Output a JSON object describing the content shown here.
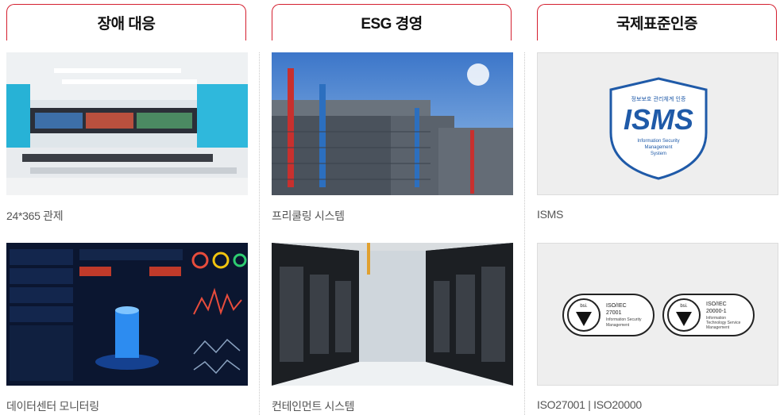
{
  "columns": [
    {
      "title": "장애 대응",
      "items": [
        {
          "caption": "24*365 관제",
          "image": "control-room-photo"
        },
        {
          "caption": "데이터센터 모니터링",
          "image": "monitoring-dashboard-screen"
        }
      ]
    },
    {
      "title": "ESG 경영",
      "items": [
        {
          "caption": "프리쿨링 시스템",
          "image": "free-cooling-towers-photo"
        },
        {
          "caption": "컨테인먼트 시스템",
          "image": "server-aisle-containment-photo"
        }
      ]
    },
    {
      "title": "국제표준인증",
      "items": [
        {
          "caption": "ISMS",
          "image": "isms-certification-logo"
        },
        {
          "caption": "ISO27001 | ISO20000",
          "image": "iso-certification-logos"
        }
      ]
    }
  ],
  "isms_logo": {
    "top_text": "정보보호 관리체계 인증",
    "main_text": "ISMS",
    "sub_lines": [
      "Information Security",
      "Management",
      "System"
    ]
  },
  "iso_logos": [
    {
      "brand": "bsi.",
      "std": "ISO/IEC",
      "num": "27001",
      "desc": [
        "Information Security",
        "Management"
      ]
    },
    {
      "brand": "bsi.",
      "std": "ISO/IEC",
      "num": "20000-1",
      "desc": [
        "Information",
        "Technology Service",
        "Management"
      ]
    }
  ],
  "colors": {
    "accent": "#d41f2f",
    "isms_blue": "#1f5aa8",
    "text": "#555555"
  }
}
